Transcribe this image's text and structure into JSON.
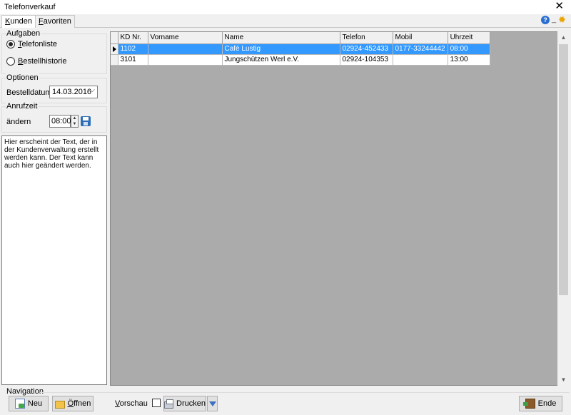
{
  "window": {
    "title": "Telefonverkauf",
    "close_glyph": "✕"
  },
  "tabs": [
    {
      "label_accel": "K",
      "label_rest": "unden",
      "active": true
    },
    {
      "label_accel": "F",
      "label_rest": "avoriten",
      "active": false
    }
  ],
  "header_icons": [
    "help-icon",
    "pin-icon",
    "gear-icon"
  ],
  "sidebar": {
    "aufgaben": {
      "title": "Aufgaben",
      "options": [
        {
          "accel": "T",
          "rest": "elefonliste",
          "selected": true
        },
        {
          "accel": "B",
          "rest": "estellhistorie",
          "selected": false
        }
      ]
    },
    "optionen": {
      "title": "Optionen",
      "bestelldatum_label": "Bestelldatum",
      "bestelldatum_value": "14.03.2016"
    },
    "anrufzeit": {
      "title": "Anrufzeit",
      "aendern_label": "ändern",
      "time_value": "08:00"
    },
    "notes": "Hier erscheint der Text, der in der Kundenverwaltung erstellt werden kann. Der Text kann auch hier geändert werden."
  },
  "grid": {
    "columns": [
      "KD Nr.",
      "Vorname",
      "Name",
      "Telefon",
      "Mobil",
      "Uhrzeit"
    ],
    "rows": [
      {
        "kdnr": "1102",
        "vorname": "",
        "name": "Café Lustig",
        "telefon": "02924-452433",
        "mobil": "0177-33244442",
        "uhrzeit": "08:00",
        "selected": true
      },
      {
        "kdnr": "3101",
        "vorname": "",
        "name": "Jungschützen Werl e.V.",
        "telefon": "02924-104353",
        "mobil": "",
        "uhrzeit": "13:00",
        "selected": false
      }
    ]
  },
  "navigation": {
    "title": "Navigation",
    "neu": "Neu",
    "oeffnen_accel": "Ö",
    "oeffnen_rest": "ffnen",
    "vorschau_accel": "V",
    "vorschau_rest": "orschau",
    "drucken": "Drucken",
    "ende": "Ende"
  },
  "colors": {
    "selection": "#3399ff",
    "panel": "#f0f0f0"
  }
}
